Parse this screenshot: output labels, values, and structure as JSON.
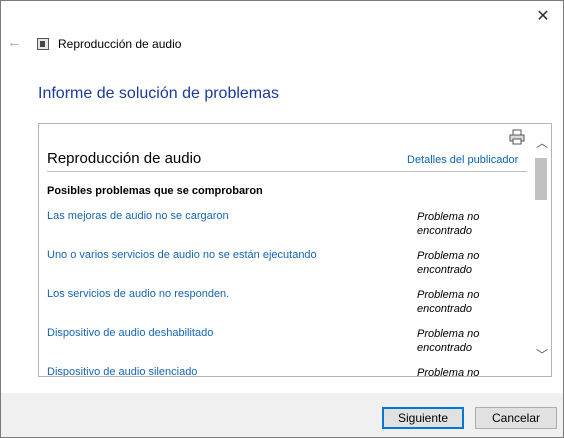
{
  "window": {
    "title": "Reproducción de audio"
  },
  "report": {
    "heading": "Informe de solución de problemas",
    "section_title": "Reproducción de audio",
    "publisher_link": "Detalles del publicador",
    "checked_heading": "Posibles problemas que se comprobaron",
    "issues": [
      {
        "issue": "Las mejoras de audio no se cargaron",
        "status": "Problema no encontrado"
      },
      {
        "issue": "Uno o varios servicios de audio no se están ejecutando",
        "status": "Problema no encontrado"
      },
      {
        "issue": "Los servicios de audio no responden.",
        "status": "Problema no encontrado"
      },
      {
        "issue": "Dispositivo de audio deshabilitado",
        "status": "Problema no encontrado"
      },
      {
        "issue": "Dispositivo de audio silenciado",
        "status": "Problema no encontrado"
      }
    ]
  },
  "buttons": {
    "next": "Siguiente",
    "cancel": "Cancelar"
  },
  "icons": {
    "close": "close-icon",
    "back": "back-arrow-icon",
    "app": "audio-app-icon",
    "print": "print-icon",
    "scroll_up": "chevron-up-icon",
    "scroll_down": "chevron-down-icon"
  },
  "colors": {
    "heading": "#1a3a9c",
    "link": "#1565b5",
    "primary_button_border": "#0078d7"
  }
}
